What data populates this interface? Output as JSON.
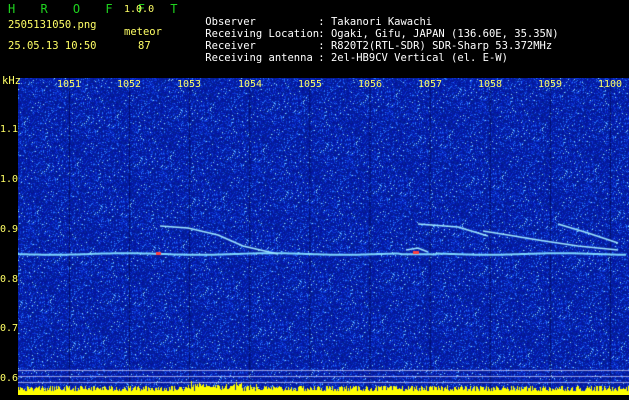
{
  "header": {
    "brand": "H R O F F T",
    "version": "1.0.0",
    "filename": "2505131050.png",
    "meteor_label": "meteor",
    "datetime": "25.05.13 10:50",
    "meteor_count": "87"
  },
  "info": [
    {
      "key": "Observer",
      "value": ": Takanori Kawachi"
    },
    {
      "key": "Receiving Location",
      "value": ": Ogaki, Gifu, JAPAN (136.60E, 35.35N)"
    },
    {
      "key": "Receiver",
      "value": ": R820T2(RTL-SDR) SDR-Sharp 53.372MHz"
    },
    {
      "key": "Receiving antenna",
      "value": ": 2el-HB9CV Vertical (el. E-W)"
    }
  ],
  "axis": {
    "y_unit": "kHz",
    "y_ticks": [
      "1.1",
      "1.0",
      "0.9",
      "0.8",
      "0.7",
      "0.6"
    ],
    "x_ticks": [
      "1051",
      "1052",
      "1053",
      "1054",
      "1055",
      "1056",
      "1057",
      "1058",
      "1059",
      "1100"
    ]
  },
  "colors": {
    "background": "#000000",
    "header_text": "#1fd21f",
    "label_text": "#ffff66",
    "info_text": "#ffffff",
    "noise_dark": "#04109a",
    "noise_light": "#2d6cff",
    "trace": "#9fe8ff",
    "signal_bar": "#ffff00"
  }
}
